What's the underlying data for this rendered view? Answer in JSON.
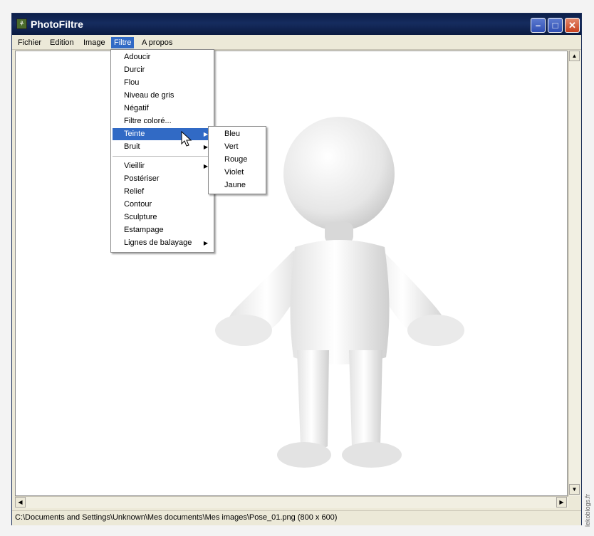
{
  "window": {
    "title": "PhotoFiltre",
    "icon": "photofiltre-app-icon",
    "buttons": [
      "minimize-icon",
      "maximize-icon",
      "close-icon"
    ]
  },
  "menubar": {
    "items": [
      {
        "label": "Fichier"
      },
      {
        "label": "Edition"
      },
      {
        "label": "Image"
      },
      {
        "label": "Filtre",
        "active": true
      },
      {
        "label": "A propos"
      }
    ]
  },
  "filtre_menu": {
    "items": [
      {
        "label": "Adoucir"
      },
      {
        "label": "Durcir"
      },
      {
        "label": "Flou"
      },
      {
        "label": "Niveau de gris"
      },
      {
        "label": "Négatif"
      },
      {
        "label": "Filtre coloré..."
      },
      {
        "label": "Teinte",
        "submenu": true,
        "highlighted": true
      },
      {
        "label": "Bruit",
        "submenu": true
      },
      {
        "label": "Vieillir",
        "submenu": true
      },
      {
        "label": "Postériser"
      },
      {
        "label": "Relief"
      },
      {
        "label": "Contour"
      },
      {
        "label": "Sculpture"
      },
      {
        "label": "Estampage"
      },
      {
        "label": "Lignes de balayage",
        "submenu": true
      }
    ]
  },
  "teinte_submenu": {
    "items": [
      {
        "label": "Bleu"
      },
      {
        "label": "Vert"
      },
      {
        "label": "Rouge"
      },
      {
        "label": "Violet"
      },
      {
        "label": "Jaune"
      }
    ]
  },
  "statusbar": {
    "path": "C:\\Documents and Settings\\Unknown\\Mes documents\\Mes images\\Pose_01.png (800 x 600)"
  },
  "watermark": "lekoblogs.fr",
  "colors": {
    "titlebar": "#0c1f49",
    "menu_highlight": "#316ac5",
    "close_button": "#c8401d"
  }
}
